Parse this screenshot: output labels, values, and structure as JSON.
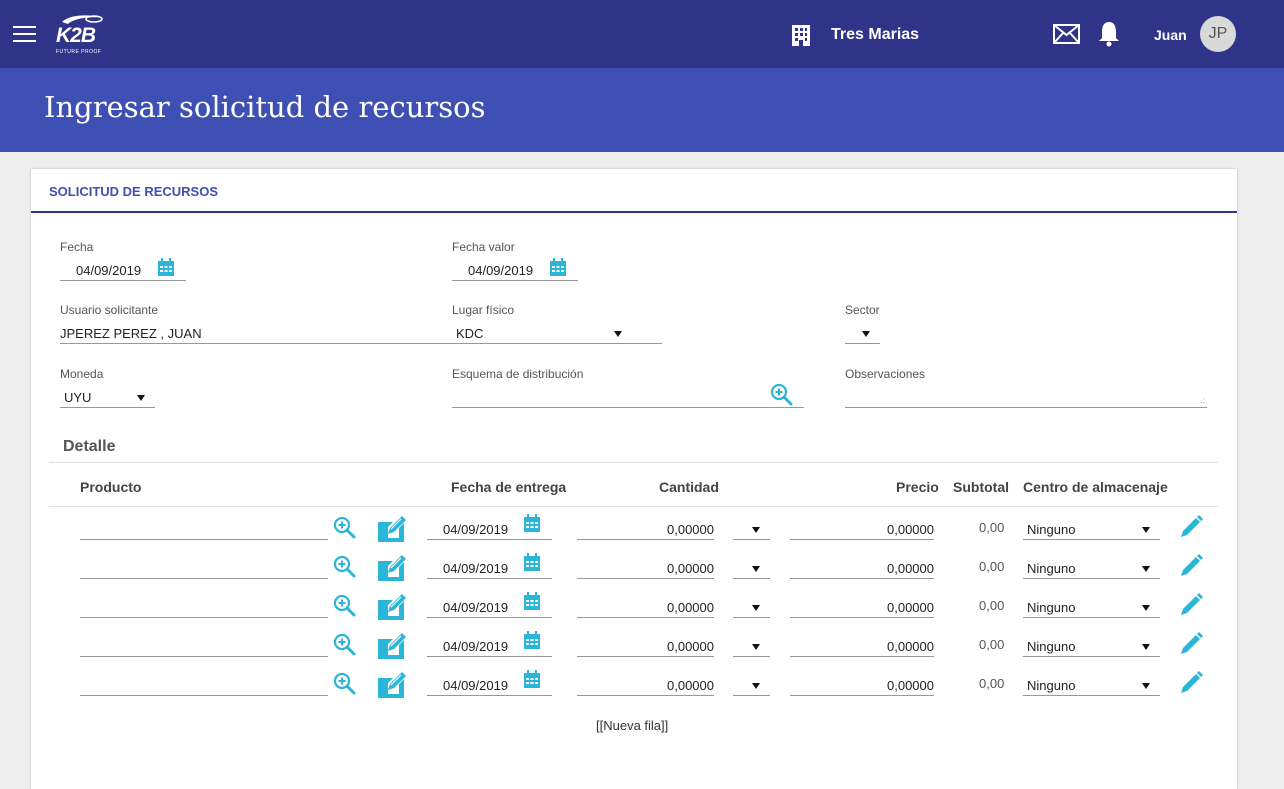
{
  "header": {
    "menu_icon": "hamburger-menu-icon",
    "logo_text": "K2B",
    "logo_tagline": "FUTURE PROOF",
    "company_icon": "building-icon",
    "company": "Tres Marias",
    "mail_icon": "mail-icon",
    "bell_icon": "bell-icon",
    "user_name": "Juan",
    "user_initials": "JP"
  },
  "page_title": "Ingresar solicitud de recursos",
  "form": {
    "section_title": "SOLICITUD DE RECURSOS",
    "fecha": {
      "label": "Fecha",
      "value": "04/09/2019"
    },
    "fecha_valor": {
      "label": "Fecha valor",
      "value": "04/09/2019"
    },
    "usuario": {
      "label": "Usuario solicitante",
      "value": "JPEREZ PEREZ , JUAN"
    },
    "lugar": {
      "label": "Lugar físico",
      "value": "KDC"
    },
    "sector": {
      "label": "Sector",
      "value": ""
    },
    "moneda": {
      "label": "Moneda",
      "value": "UYU"
    },
    "esquema": {
      "label": "Esquema de distribución",
      "value": ""
    },
    "observaciones": {
      "label": "Observaciones",
      "value": ""
    }
  },
  "detalle": {
    "title": "Detalle",
    "columns": {
      "producto": "Producto",
      "fecha_entrega": "Fecha de entrega",
      "cantidad": "Cantidad",
      "precio": "Precio",
      "subtotal": "Subtotal",
      "centro": "Centro de almacenaje"
    },
    "rows": [
      {
        "producto": "",
        "fecha": "04/09/2019",
        "cantidad": "0,00000",
        "unidad": "",
        "precio": "0,00000",
        "subtotal": "0,00",
        "centro": "Ninguno"
      },
      {
        "producto": "",
        "fecha": "04/09/2019",
        "cantidad": "0,00000",
        "unidad": "",
        "precio": "0,00000",
        "subtotal": "0,00",
        "centro": "Ninguno"
      },
      {
        "producto": "",
        "fecha": "04/09/2019",
        "cantidad": "0,00000",
        "unidad": "",
        "precio": "0,00000",
        "subtotal": "0,00",
        "centro": "Ninguno"
      },
      {
        "producto": "",
        "fecha": "04/09/2019",
        "cantidad": "0,00000",
        "unidad": "",
        "precio": "0,00000",
        "subtotal": "0,00",
        "centro": "Ninguno"
      },
      {
        "producto": "",
        "fecha": "04/09/2019",
        "cantidad": "0,00000",
        "unidad": "",
        "precio": "0,00000",
        "subtotal": "0,00",
        "centro": "Ninguno"
      }
    ],
    "new_row": "[[Nueva fila]]"
  },
  "colors": {
    "topbar": "#303489",
    "titleband": "#3e50b4",
    "accent_icon": "#29b6d8"
  }
}
